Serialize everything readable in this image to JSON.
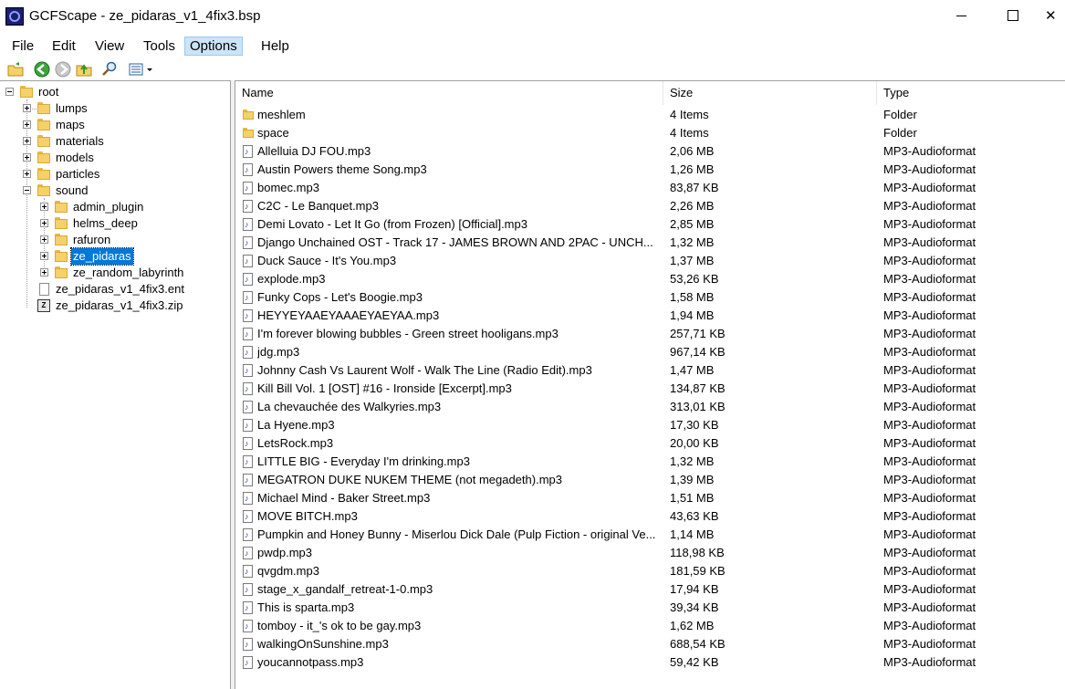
{
  "window": {
    "title": "GCFScape - ze_pidaras_v1_4fix3.bsp",
    "close_glyph": "✕"
  },
  "menu": [
    "File",
    "Edit",
    "View",
    "Tools",
    "Options",
    "Help"
  ],
  "menu_active": "Options",
  "toolbar": {
    "icons": [
      "open-folder-icon",
      "back-icon",
      "forward-icon",
      "up-folder-icon",
      "find-icon",
      "view-mode-icon"
    ]
  },
  "tree": {
    "root": "root",
    "nodes": [
      {
        "label": "lumps",
        "type": "folder"
      },
      {
        "label": "maps",
        "type": "folder"
      },
      {
        "label": "materials",
        "type": "folder"
      },
      {
        "label": "models",
        "type": "folder"
      },
      {
        "label": "particles",
        "type": "folder"
      },
      {
        "label": "sound",
        "type": "folder",
        "expanded": true
      },
      {
        "label": "admin_plugin",
        "type": "folder",
        "depth": 2
      },
      {
        "label": "helms_deep",
        "type": "folder",
        "depth": 2
      },
      {
        "label": "rafuron",
        "type": "folder",
        "depth": 2
      },
      {
        "label": "ze_pidaras",
        "type": "folder",
        "depth": 2,
        "selected": true
      },
      {
        "label": "ze_random_labyrinth",
        "type": "folder",
        "depth": 2
      },
      {
        "label": "ze_pidaras_v1_4fix3.ent",
        "type": "file"
      },
      {
        "label": "ze_pidaras_v1_4fix3.zip",
        "type": "zip"
      }
    ],
    "zip_glyph": "Z"
  },
  "list": {
    "columns": {
      "name": "Name",
      "size": "Size",
      "type": "Type"
    },
    "rows": [
      {
        "name": "meshlem",
        "size": "4 Items",
        "type": "Folder",
        "kind": "folder"
      },
      {
        "name": "space",
        "size": "4 Items",
        "type": "Folder",
        "kind": "folder"
      },
      {
        "name": "Allelluia DJ FOU.mp3",
        "size": "2,06 MB",
        "type": "MP3-Audioformat",
        "kind": "audio"
      },
      {
        "name": "Austin Powers theme Song.mp3",
        "size": "1,26 MB",
        "type": "MP3-Audioformat",
        "kind": "audio"
      },
      {
        "name": "bomec.mp3",
        "size": "83,87 KB",
        "type": "MP3-Audioformat",
        "kind": "audio"
      },
      {
        "name": "C2C - Le Banquet.mp3",
        "size": "2,26 MB",
        "type": "MP3-Audioformat",
        "kind": "audio"
      },
      {
        "name": "Demi Lovato - Let It Go (from Frozen) [Official].mp3",
        "size": "2,85 MB",
        "type": "MP3-Audioformat",
        "kind": "audio"
      },
      {
        "name": "Django Unchained OST - Track 17 - JAMES BROWN AND 2PAC - UNCH...",
        "size": "1,32 MB",
        "type": "MP3-Audioformat",
        "kind": "audio"
      },
      {
        "name": "Duck Sauce - It's You.mp3",
        "size": "1,37 MB",
        "type": "MP3-Audioformat",
        "kind": "audio"
      },
      {
        "name": "explode.mp3",
        "size": "53,26 KB",
        "type": "MP3-Audioformat",
        "kind": "audio"
      },
      {
        "name": "Funky Cops - Let's Boogie.mp3",
        "size": "1,58 MB",
        "type": "MP3-Audioformat",
        "kind": "audio"
      },
      {
        "name": "HEYYEYAAEYAAAEYAEYAA.mp3",
        "size": "1,94 MB",
        "type": "MP3-Audioformat",
        "kind": "audio"
      },
      {
        "name": "I'm forever blowing bubbles -  Green street hooligans.mp3",
        "size": "257,71 KB",
        "type": "MP3-Audioformat",
        "kind": "audio"
      },
      {
        "name": "jdg.mp3",
        "size": "967,14 KB",
        "type": "MP3-Audioformat",
        "kind": "audio"
      },
      {
        "name": "Johnny Cash Vs Laurent Wolf - Walk The Line (Radio Edit).mp3",
        "size": "1,47 MB",
        "type": "MP3-Audioformat",
        "kind": "audio"
      },
      {
        "name": "Kill Bill Vol. 1 [OST] #16 - Ironside [Excerpt].mp3",
        "size": "134,87 KB",
        "type": "MP3-Audioformat",
        "kind": "audio"
      },
      {
        "name": "La chevauchée des Walkyries.mp3",
        "size": "313,01 KB",
        "type": "MP3-Audioformat",
        "kind": "audio"
      },
      {
        "name": "La Hyene.mp3",
        "size": "17,30 KB",
        "type": "MP3-Audioformat",
        "kind": "audio"
      },
      {
        "name": "LetsRock.mp3",
        "size": "20,00 KB",
        "type": "MP3-Audioformat",
        "kind": "audio"
      },
      {
        "name": "LITTLE BIG - Everyday I'm drinking.mp3",
        "size": "1,32 MB",
        "type": "MP3-Audioformat",
        "kind": "audio"
      },
      {
        "name": "MEGATRON DUKE NUKEM THEME (not megadeth).mp3",
        "size": "1,39 MB",
        "type": "MP3-Audioformat",
        "kind": "audio"
      },
      {
        "name": "Michael Mind - Baker Street.mp3",
        "size": "1,51 MB",
        "type": "MP3-Audioformat",
        "kind": "audio"
      },
      {
        "name": "MOVE BITCH.mp3",
        "size": "43,63 KB",
        "type": "MP3-Audioformat",
        "kind": "audio"
      },
      {
        "name": "Pumpkin and Honey Bunny - Miserlou Dick Dale (Pulp Fiction - original Ve...",
        "size": "1,14 MB",
        "type": "MP3-Audioformat",
        "kind": "audio"
      },
      {
        "name": "pwdp.mp3",
        "size": "118,98 KB",
        "type": "MP3-Audioformat",
        "kind": "audio"
      },
      {
        "name": "qvgdm.mp3",
        "size": "181,59 KB",
        "type": "MP3-Audioformat",
        "kind": "audio"
      },
      {
        "name": "stage_x_gandalf_retreat-1-0.mp3",
        "size": "17,94 KB",
        "type": "MP3-Audioformat",
        "kind": "audio"
      },
      {
        "name": "This is sparta.mp3",
        "size": "39,34 KB",
        "type": "MP3-Audioformat",
        "kind": "audio"
      },
      {
        "name": "tomboy - it_'s ok to be gay.mp3",
        "size": "1,62 MB",
        "type": "MP3-Audioformat",
        "kind": "audio"
      },
      {
        "name": "walkingOnSunshine.mp3",
        "size": "688,54 KB",
        "type": "MP3-Audioformat",
        "kind": "audio"
      },
      {
        "name": "youcannotpass.mp3",
        "size": "59,42 KB",
        "type": "MP3-Audioformat",
        "kind": "audio"
      }
    ]
  },
  "colors": {
    "selection": "#0078d7",
    "menu_active_bg": "#cce4f7",
    "folder": "#f6d068"
  }
}
